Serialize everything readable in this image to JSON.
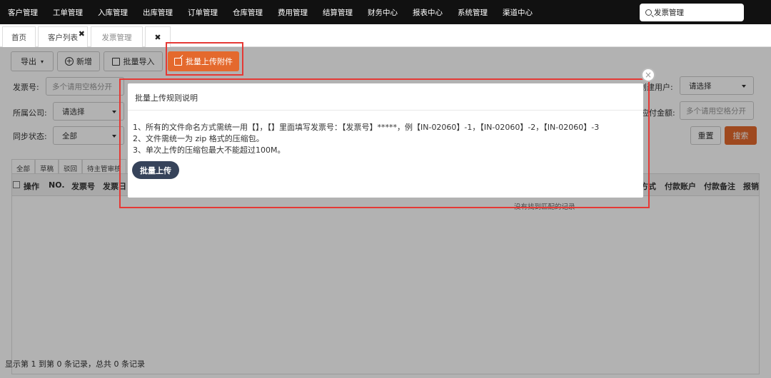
{
  "nav": {
    "items": [
      "客户管理",
      "工单管理",
      "入库管理",
      "出库管理",
      "订单管理",
      "仓库管理",
      "费用管理",
      "结算管理",
      "财务中心",
      "报表中心",
      "系统管理",
      "渠道中心"
    ],
    "search_value": "发票管理"
  },
  "tabs": [
    {
      "label": "首页"
    },
    {
      "label": "客户列表"
    },
    {
      "label": "发票管理"
    }
  ],
  "toolbar": {
    "export": "导出",
    "add": "新增",
    "import": "批量导入",
    "upload": "批量上传附件"
  },
  "filters": {
    "invoice_no_label": "发票号:",
    "invoice_no_placeholder": "多个请用空格分开",
    "company_label": "所属公司:",
    "company_value": "请选择",
    "sync_label": "同步状态:",
    "sync_value": "全部",
    "creator_label": "创建用户:",
    "creator_value": "请选择",
    "amount_label": "应付金额:",
    "amount_placeholder": "多个请用空格分开",
    "reset": "重置",
    "search": "搜索"
  },
  "subtabs": [
    "全部",
    "草稿",
    "驳回",
    "待主管审核"
  ],
  "table": {
    "columns_left": [
      "操作",
      "NO.",
      "发票号",
      "发票日"
    ],
    "columns_right": [
      "方式",
      "付款账户",
      "付款备注",
      "报销"
    ],
    "empty": "没有找到匹配的记录"
  },
  "footer": "显示第 1 到第 0 条记录，总共 0 条记录",
  "modal": {
    "title": "批量上传规则说明",
    "rules": [
      "1、所有的文件命名方式需统一用【】，【】里面填写发票号：【发票号】*****，例【IN-02060】-1，【IN-02060】-2，【IN-02060】-3",
      "2、文件需统一为 zip 格式的压缩包。",
      "3、单次上传的压缩包最大不能超过100M。"
    ],
    "button": "批量上传"
  },
  "colors": {
    "accent": "#e4692d",
    "highlight": "#e53935",
    "modal_button": "#36435a"
  }
}
